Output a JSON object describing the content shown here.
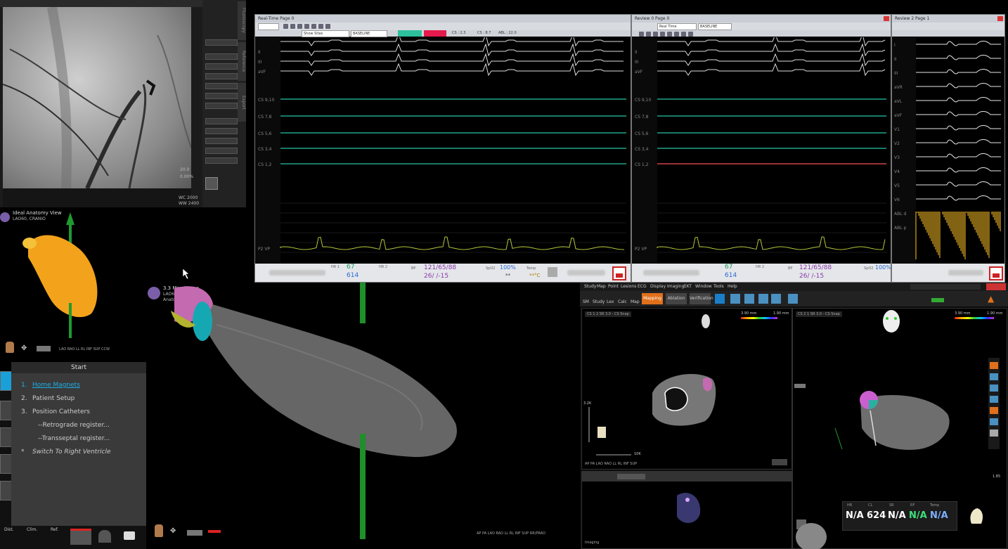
{
  "fluoro": {
    "side_labels": [
      "Fluoroscopy",
      "Reference",
      "Export"
    ],
    "bottom_texts": [
      "WC 2000",
      "WW 2400"
    ],
    "side_values": [
      "20.0",
      "0.00%"
    ]
  },
  "ep_windows": [
    {
      "title": "Real-Time Page 0",
      "dropdowns": [
        "Show Sites",
        "BASELINE"
      ],
      "chip_labels": [
        "CS : 2.3",
        "CS : 8.7",
        "ABL : 22.0"
      ],
      "channels": [
        {
          "label": "",
          "color": "#dcdcdc",
          "kind": "ecg"
        },
        {
          "label": "II",
          "color": "#dcdcdc",
          "kind": "ecg"
        },
        {
          "label": "III",
          "color": "#dcdcdc",
          "kind": "ecg"
        },
        {
          "label": "aVF",
          "color": "#dcdcdc",
          "kind": "ecg"
        },
        {
          "label": "CS 9,10",
          "color": "#1fa487",
          "kind": "flat"
        },
        {
          "label": "CS 7,8",
          "color": "#1fa487",
          "kind": "flat"
        },
        {
          "label": "CS 5,6",
          "color": "#1fa487",
          "kind": "flat"
        },
        {
          "label": "CS 3,4",
          "color": "#1fa487",
          "kind": "flat"
        },
        {
          "label": "CS 1,2",
          "color": "#1fa487",
          "kind": "flat"
        }
      ],
      "bottom_channel": {
        "label": "P2 VP",
        "color": "#b4c43a"
      },
      "vitals": {
        "hr": "67",
        "spo": "614",
        "bp": "121/65/88",
        "pa": "26/ /-15",
        "spo2": "100%",
        "temp": "**°C",
        "rr": "**",
        "hr2_label": "HR 2",
        "bp_label": "BP",
        "spo2_label": "SpO2",
        "temp_label": "Temp"
      }
    },
    {
      "title": "Review 0 Page 0",
      "dropdowns": [
        "Real Time",
        "BASELINE"
      ],
      "chip_labels": [],
      "channels": [
        {
          "label": "",
          "color": "#dcdcdc",
          "kind": "ecg"
        },
        {
          "label": "II",
          "color": "#dcdcdc",
          "kind": "ecg"
        },
        {
          "label": "III",
          "color": "#dcdcdc",
          "kind": "ecg"
        },
        {
          "label": "aVF",
          "color": "#dcdcdc",
          "kind": "ecg"
        },
        {
          "label": "CS 9,10",
          "color": "#1fa487",
          "kind": "flat"
        },
        {
          "label": "CS 7,8",
          "color": "#1fa487",
          "kind": "flat"
        },
        {
          "label": "CS 5,6",
          "color": "#1fa487",
          "kind": "flat"
        },
        {
          "label": "CS 3,4",
          "color": "#1fa487",
          "kind": "flat"
        },
        {
          "label": "CS 1,2",
          "color": "#d0434b",
          "kind": "flat"
        }
      ],
      "bottom_channel": {
        "label": "P2 VP",
        "color": "#b4c43a"
      },
      "vitals": {
        "hr": "67",
        "spo": "614",
        "bp": "121/65/88",
        "pa": "26/ /-15",
        "spo2": "100%",
        "temp": "**°C",
        "rr": "**",
        "hr2_label": "HR 2",
        "bp_label": "BP",
        "spo2_label": "SpO2",
        "temp_label": "Temp"
      }
    }
  ],
  "ep_window_3": {
    "title": "Review 2 Page 1",
    "labels": [
      "I",
      "II",
      "III",
      "aVR",
      "aVL",
      "aVF",
      "V1",
      "V2",
      "V3",
      "V4",
      "V5",
      "V6",
      "ABL d",
      "ABL p"
    ]
  },
  "carto": {
    "left_view_title": "Ideal Anatomy View",
    "left_view_sub": "LAO60, CRANIO",
    "main_view_title": "3.3 Map Name",
    "main_view_sub": "LAO60, CRANIO",
    "main_view_sub2": "Anatomy Map",
    "orientation_labels": "LAO RAO LL RL INF SUP CCW",
    "main_orientation_labels": "AP PA LAO RAO LL RL INF SUP RR/PRAO",
    "workflow": {
      "title": "Start",
      "items": [
        {
          "num": "1.",
          "label": "Home Magnets",
          "active": true
        },
        {
          "num": "2.",
          "label": "Patient Setup",
          "active": false
        },
        {
          "num": "3.",
          "label": "Position Catheters",
          "active": false
        },
        {
          "num": "",
          "label": "--Retrograde register...",
          "active": false
        },
        {
          "num": "",
          "label": "--Transseptal register...",
          "active": false
        },
        {
          "num": "*",
          "label": "Switch To Right Ventricle",
          "active": false,
          "italic": true
        }
      ]
    },
    "bottom_tools": [
      "Dist.",
      "Clim.",
      "Ref."
    ]
  },
  "carto_right": {
    "menu": [
      "Study",
      "Map",
      "Point",
      "Lesions",
      "ECG",
      "Display",
      "Imaging",
      "EKT",
      "Window",
      "Tools",
      "Help"
    ],
    "toolbar_labels": [
      "SM",
      "Study",
      "Lex",
      "Calc",
      "Map"
    ],
    "workflow_buttons": [
      "Mapping",
      "Ablation",
      "Verification"
    ],
    "map1_title": "CS 1 2 SR 3.0 - CS Snap",
    "map2_title": "CS 2 1 SR 3.0 - CS Snap",
    "scale_top": "3.90 mm",
    "scale_end": "1.90 mm",
    "map1_scale_val": "3.2K",
    "map2_scale_val": "1.85",
    "dist_val": "10K",
    "na_labels": [
      "HR",
      "CL",
      "SR",
      "RF",
      "Temp"
    ],
    "na_values": [
      "N/A",
      "624",
      "N/A",
      "N/A",
      "N/A"
    ],
    "na_colors": [
      "#ffffff",
      "#ffffff",
      "#ffffff",
      "#3ee07d",
      "#7db0ff"
    ],
    "map1_bottom": "AP PA LAO RAO LL RL INF SUP",
    "bottom_label": "Imaging"
  }
}
